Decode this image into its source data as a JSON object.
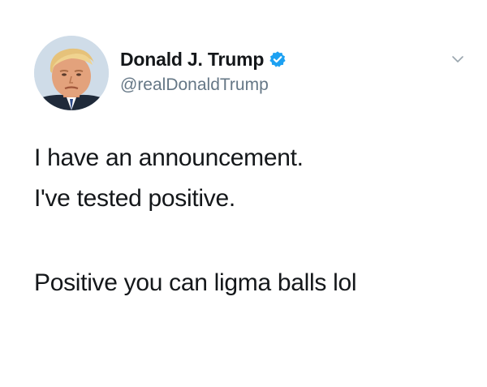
{
  "tweet": {
    "author": {
      "display_name": "Donald J. Trump",
      "handle": "@realDonaldTrump",
      "verified": true,
      "verified_icon": "verified-badge-icon",
      "avatar": "profile-photo"
    },
    "menu_icon": "chevron-down-icon",
    "text_lines": [
      "I have an announcement.",
      "I've tested positive.",
      "Positive you can ligma balls lol"
    ]
  },
  "colors": {
    "text_primary": "#14171a",
    "text_secondary": "#657786",
    "verified_blue": "#1da1f2",
    "background": "#ffffff"
  }
}
